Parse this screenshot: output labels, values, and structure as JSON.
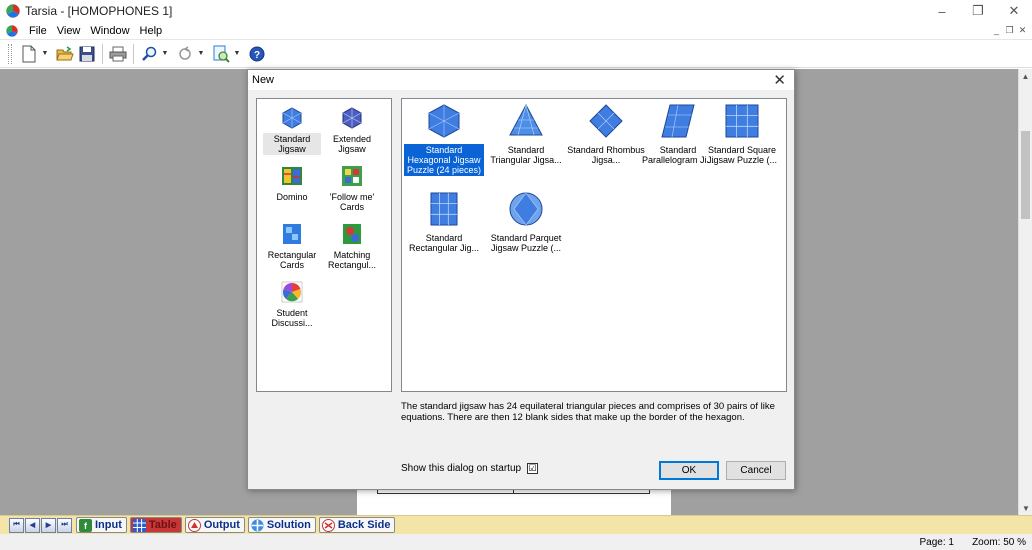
{
  "window": {
    "title": "Tarsia - [HOMOPHONES 1]",
    "controls": {
      "minimize": "–",
      "restore": "❐",
      "close": "✕"
    },
    "mdi_controls": {
      "minimize": "_",
      "restore": "❐",
      "close": "✕"
    }
  },
  "menubar": {
    "items": [
      "File",
      "View",
      "Window",
      "Help"
    ]
  },
  "toolbar": {
    "buttons": [
      "new-icon",
      "open-icon",
      "save-icon",
      "print-icon",
      "zoom-icon",
      "rotate-icon",
      "preview-icon",
      "help-icon"
    ]
  },
  "dialog": {
    "title": "New",
    "close": "✕",
    "categories": [
      {
        "label": "Standard Jigsaw",
        "icon": "hex-jigsaw-icon",
        "selected": true
      },
      {
        "label": "Extended Jigsaw",
        "icon": "extended-jigsaw-icon",
        "selected": false
      },
      {
        "label": "Domino",
        "icon": "domino-icon",
        "selected": false
      },
      {
        "label": "'Follow me' Cards",
        "icon": "follow-me-icon",
        "selected": false
      },
      {
        "label": "Rectangular Cards",
        "icon": "rectangular-cards-icon",
        "selected": false
      },
      {
        "label": "Matching Rectangul...",
        "icon": "matching-rect-icon",
        "selected": false
      },
      {
        "label": "Student Discussi...",
        "icon": "student-discussion-icon",
        "selected": false
      }
    ],
    "templates": [
      {
        "label": "Standard Hexagonal Jigsaw Puzzle (24 pieces)",
        "selected": true
      },
      {
        "label": "Standard Triangular Jigsa...",
        "selected": false
      },
      {
        "label": "Standard Rhombus Jigsa...",
        "selected": false
      },
      {
        "label": "Standard Parallelogram Ji...",
        "selected": false
      },
      {
        "label": "Standard Square Jigsaw Puzzle (...",
        "selected": false
      },
      {
        "label": "Standard Rectangular Jig...",
        "selected": false
      },
      {
        "label": "Standard Parquet Jigsaw Puzzle (...",
        "selected": false
      }
    ],
    "description": "The standard jigsaw has 24 equilateral triangular pieces and comprises of 30 pairs of like equations. There are then 12 blank sides that make up the border of the hexagon.",
    "show_on_startup_label": "Show this dialog on startup",
    "show_on_startup_checked": "☑",
    "ok_label": "OK",
    "cancel_label": "Cancel"
  },
  "tabs": {
    "nav": [
      "⏮",
      "◀",
      "▶",
      "⏭"
    ],
    "items": [
      {
        "label": "Input",
        "active": false
      },
      {
        "label": "Table",
        "active": true
      },
      {
        "label": "Output",
        "active": false
      },
      {
        "label": "Solution",
        "active": false
      },
      {
        "label": "Back Side",
        "active": false
      }
    ]
  },
  "status": {
    "page": "Page: 1",
    "zoom": "Zoom: 50 %"
  },
  "colors": {
    "workspace": "#a0a0a0",
    "selection": "#0a64d6",
    "tabbar": "#f3e4a8"
  }
}
